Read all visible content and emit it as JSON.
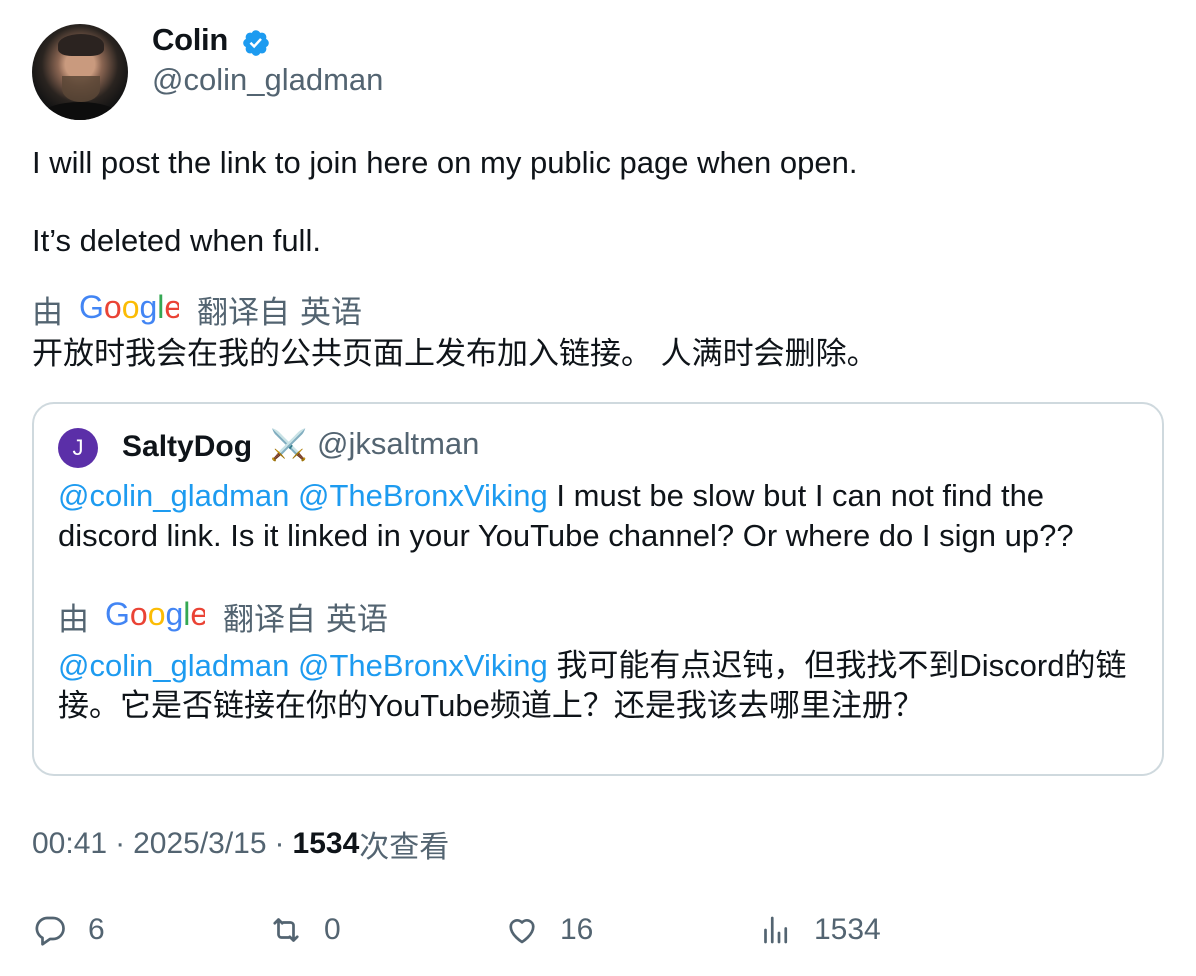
{
  "author": {
    "name": "Colin",
    "handle": "@colin_gladman",
    "verified": true,
    "avatar": "profile-photo"
  },
  "tweet": {
    "paragraphs": [
      "I will post the link to join here on my public page when open.",
      "It’s deleted when full."
    ],
    "translation": {
      "prefix": "由",
      "provider": "Google",
      "suffix": "翻译自",
      "source_language": "英语",
      "text": "开放时我会在我的公共页面上发布加入链接。 人满时会删除。"
    }
  },
  "quote": {
    "avatar_letter": "J",
    "avatar_color": "#5b2fa8",
    "name": "SaltyDog",
    "emoji": "⚔️",
    "handle": "@jksaltman",
    "mentions": [
      "@colin_gladman",
      "@TheBronxViking"
    ],
    "text": "I must be slow but I can not find the discord link. Is it linked in your YouTube channel? Or where do I sign up??",
    "translation": {
      "prefix": "由",
      "provider": "Google",
      "suffix": "翻译自",
      "source_language": "英语",
      "text": "我可能有点迟钝，但我找不到Discord的链接。它是否链接在你的YouTube频道上？还是我该去哪里注册？"
    }
  },
  "meta": {
    "time": "00:41",
    "date": "2025/3/15",
    "views": "1534",
    "views_label": "次查看",
    "separator": "·"
  },
  "actions": {
    "replies": "6",
    "reposts": "0",
    "likes": "16",
    "views": "1534"
  },
  "colors": {
    "link": "#1d9bf0",
    "secondary_text": "#536471",
    "primary_text": "#0f1419",
    "border": "#cfd9de"
  }
}
